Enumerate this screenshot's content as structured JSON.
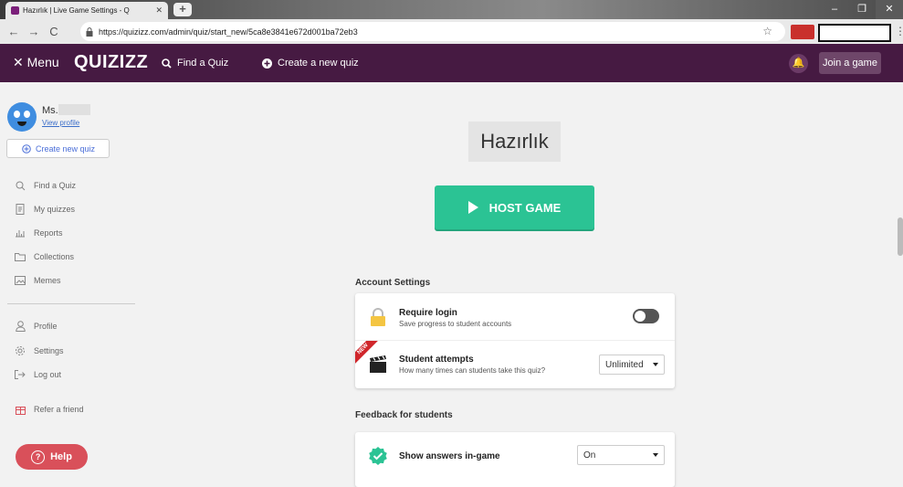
{
  "browser": {
    "tab_title": "Hazırlık | Live Game Settings - Q",
    "url": "https://quizizz.com/admin/quiz/start_new/5ca8e3841e672d001ba72eb3"
  },
  "header": {
    "menu_label": "✕ Menu",
    "logo": "QUIZIZZ",
    "find_quiz": "Find a Quiz",
    "create_quiz": "Create a new quiz",
    "join_game": "Join a game",
    "bg_color": "#461a42"
  },
  "sidebar": {
    "user_name": "Ms.",
    "view_profile": "View profile",
    "create_new_quiz": "Create new quiz",
    "items": [
      {
        "label": "Find a Quiz",
        "icon": "search-icon"
      },
      {
        "label": "My quizzes",
        "icon": "document-icon"
      },
      {
        "label": "Reports",
        "icon": "bar-chart-icon"
      },
      {
        "label": "Collections",
        "icon": "folder-icon"
      },
      {
        "label": "Memes",
        "icon": "image-icon"
      }
    ],
    "bottom_items": [
      {
        "label": "Profile",
        "icon": "user-icon"
      },
      {
        "label": "Settings",
        "icon": "gear-icon"
      },
      {
        "label": "Log out",
        "icon": "logout-icon"
      },
      {
        "label": "Refer a friend",
        "icon": "gift-icon"
      }
    ],
    "help": "Help"
  },
  "main": {
    "quiz_title": "Hazırlık",
    "host_game": "HOST GAME",
    "account_settings": {
      "heading": "Account Settings",
      "require_login": {
        "title": "Require login",
        "subtitle": "Save progress to student accounts",
        "enabled": false
      },
      "student_attempts": {
        "badge": "NEW",
        "title": "Student attempts",
        "subtitle": "How many times can students take this quiz?",
        "value": "Unlimited"
      }
    },
    "feedback": {
      "heading": "Feedback for students",
      "show_answers": {
        "title": "Show answers in-game",
        "value": "On"
      }
    }
  },
  "colors": {
    "accent_green": "#2bc394",
    "help_red": "#d9505a"
  }
}
